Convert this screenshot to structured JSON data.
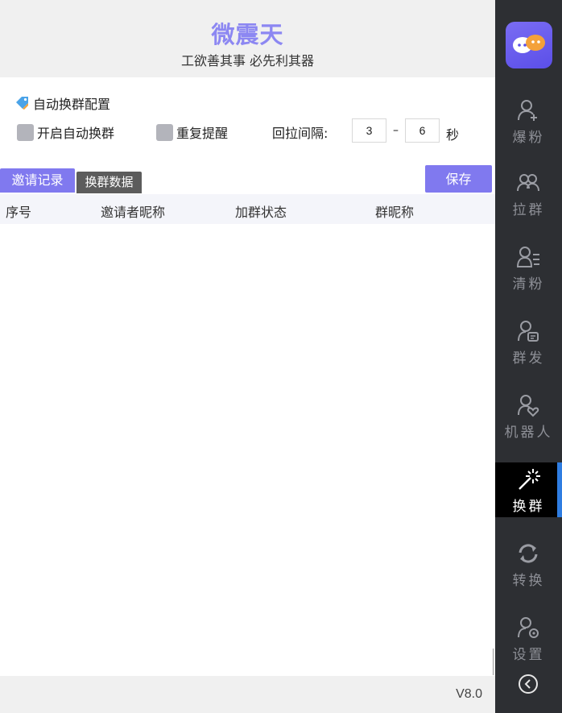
{
  "header": {
    "title": "微震天",
    "subtitle": "工欲善其事 必先利其器"
  },
  "config": {
    "section_title": "自动换群配置",
    "enable_auto_switch": "开启自动换群",
    "repeat_reminder": "重复提醒",
    "interval_label": "回拉间隔:",
    "interval_min": "3",
    "interval_sep": "–",
    "interval_max": "6",
    "interval_unit": "秒"
  },
  "tabs": {
    "invite_records": "邀请记录",
    "switch_data": "换群数据"
  },
  "save_label": "保存",
  "table": {
    "columns": [
      "序号",
      "邀请者昵称",
      "加群状态",
      "群昵称"
    ],
    "rows": []
  },
  "footer": {
    "version": "V8.0"
  },
  "sidebar": {
    "items": [
      {
        "label": "爆粉",
        "icon": "user-plus-icon"
      },
      {
        "label": "拉群",
        "icon": "users-icon"
      },
      {
        "label": "清粉",
        "icon": "user-list-icon"
      },
      {
        "label": "群发",
        "icon": "user-message-icon"
      },
      {
        "label": "机器人",
        "icon": "user-heart-icon"
      },
      {
        "label": "换群",
        "icon": "magic-wand-icon",
        "active": true
      },
      {
        "label": "转换",
        "icon": "refresh-icon"
      },
      {
        "label": "设置",
        "icon": "user-gear-icon"
      }
    ]
  },
  "colors": {
    "accent": "#8079ef",
    "sidebar_bg": "#2d2f33",
    "active_indicator": "#2f7de1"
  }
}
